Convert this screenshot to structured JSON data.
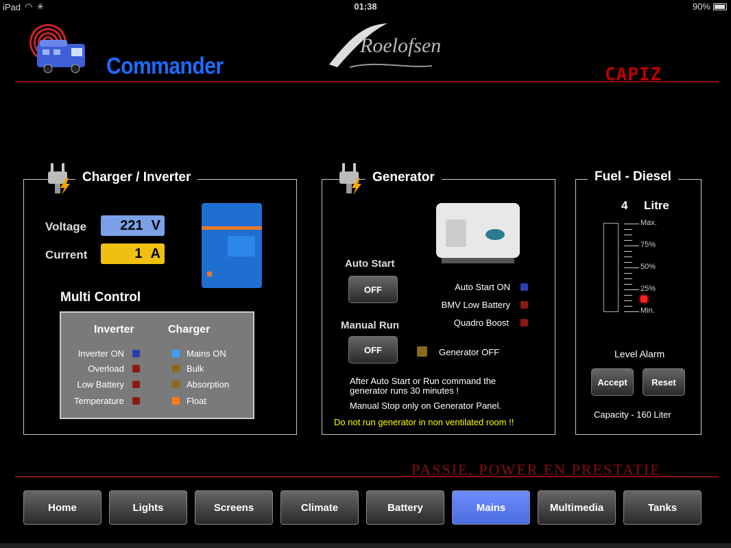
{
  "status": {
    "device": "iPad",
    "time": "01:38",
    "battery": "90%"
  },
  "header": {
    "app_name": "Commander",
    "brand": "Roelofsen",
    "partner": "CAPIZ"
  },
  "charger": {
    "title": "Charger / Inverter",
    "voltage_label": "Voltage",
    "voltage_value": "221",
    "voltage_unit": "V",
    "current_label": "Current",
    "current_value": "1",
    "current_unit": "A",
    "multi_title": "Multi Control",
    "inverter_head": "Inverter",
    "charger_head": "Charger",
    "inverter_rows": [
      "Inverter ON",
      "Overload",
      "Low Battery",
      "Temperature"
    ],
    "charger_rows": [
      "Mains ON",
      "Bulk",
      "Absorption",
      "Float"
    ]
  },
  "generator": {
    "title": "Generator",
    "auto_start_label": "Auto Start",
    "auto_start_btn": "OFF",
    "manual_run_label": "Manual Run",
    "manual_run_btn": "OFF",
    "status_rows": [
      "Auto Start ON",
      "BMV Low Battery",
      "Quadro Boost"
    ],
    "gen_status": "Generator OFF",
    "note1": "After Auto Start or Run command the generator runs 30 minutes !",
    "note2": "Manual Stop only on Generator Panel.",
    "warning": "Do not run generator in non ventilated room !!"
  },
  "fuel": {
    "title": "Fuel - Diesel",
    "amount": "4",
    "unit": "Litre",
    "scale": [
      "Max.",
      "75%",
      "50%",
      "25%",
      "Min."
    ],
    "level_alarm": "Level Alarm",
    "accept": "Accept",
    "reset": "Reset",
    "capacity": "Capacity - 160 Liter"
  },
  "slogan": "PASSIE, POWER EN PRESTATIE",
  "tabs": [
    "Home",
    "Lights",
    "Screens",
    "Climate",
    "Battery",
    "Mains",
    "Multimedia",
    "Tanks"
  ],
  "active_tab": "Mains",
  "colors": {
    "accent": "#4a6de0",
    "brand_red": "#8a0e12",
    "voltage_box": "#7ba0e6",
    "current_box": "#f0c010"
  }
}
